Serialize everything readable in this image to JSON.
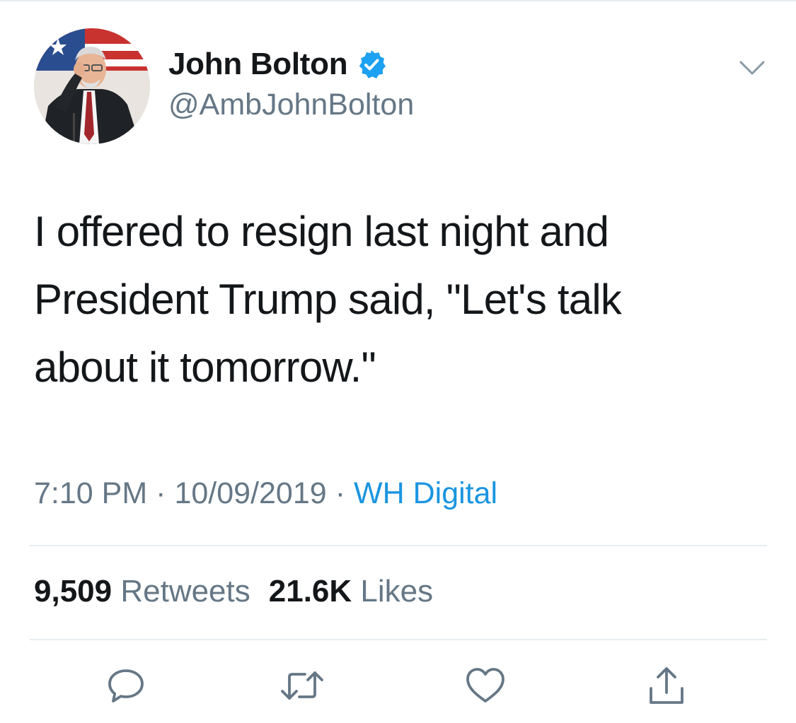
{
  "author": {
    "display_name": "John Bolton",
    "handle": "@AmbJohnBolton",
    "verified": true,
    "avatar_icon": "profile-photo-icon"
  },
  "tweet": {
    "text": "I offered to resign last night and\nPresident Trump said, \"Let's talk\nabout it tomorrow.\""
  },
  "meta": {
    "time": "7:10 PM",
    "separator": "·",
    "date": "10/09/2019",
    "source": "WH Digital"
  },
  "stats": {
    "retweets_count": "9,509",
    "retweets_label": "Retweets",
    "likes_count": "21.6K",
    "likes_label": "Likes"
  },
  "actions": [
    "reply-icon",
    "retweet-icon",
    "like-icon",
    "share-icon"
  ],
  "colors": {
    "text": "#14171a",
    "secondary": "#657786",
    "link": "#1b95e0",
    "verified": "#1da1f2",
    "divider": "#e6ecf0"
  }
}
